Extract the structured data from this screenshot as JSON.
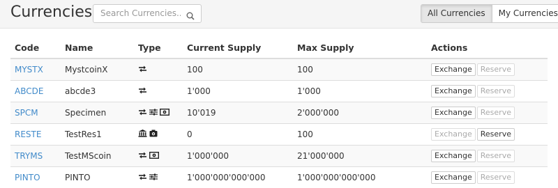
{
  "header": {
    "title": "Currencies",
    "search_placeholder": "Search Currencies..",
    "tabs": [
      {
        "label": "All Currencies",
        "active": true
      },
      {
        "label": "My Currencies",
        "active": false
      }
    ]
  },
  "table": {
    "columns": [
      "Code",
      "Name",
      "Type",
      "Current Supply",
      "Max Supply",
      "Actions"
    ],
    "actions": {
      "exchange": "Exchange",
      "reserve": "Reserve"
    },
    "rows": [
      {
        "code": "MYSTX",
        "name": "MystcoinX",
        "types": [
          "exchangeable-icon"
        ],
        "current": "100",
        "max": "100",
        "exchange_enabled": true,
        "reserve_enabled": false
      },
      {
        "code": "ABCDE",
        "name": "abcde3",
        "types": [
          "exchangeable-icon"
        ],
        "current": "1'000",
        "max": "1'000",
        "exchange_enabled": true,
        "reserve_enabled": false
      },
      {
        "code": "SPCM",
        "name": "Specimen",
        "types": [
          "exchangeable-icon",
          "controllable-icon",
          "mintable-icon"
        ],
        "current": "10'019",
        "max": "2'000'000",
        "exchange_enabled": true,
        "reserve_enabled": false
      },
      {
        "code": "RESTE",
        "name": "TestRes1",
        "types": [
          "reservable-icon",
          "claimable-icon"
        ],
        "current": "0",
        "max": "100",
        "exchange_enabled": false,
        "reserve_enabled": true
      },
      {
        "code": "TRYMS",
        "name": "TestMScoin",
        "types": [
          "exchangeable-icon",
          "mintable-icon"
        ],
        "current": "1'000'000",
        "max": "21'000'000",
        "exchange_enabled": true,
        "reserve_enabled": false
      },
      {
        "code": "PINTO",
        "name": "PINTO",
        "types": [
          "exchangeable-icon",
          "controllable-icon"
        ],
        "current": "1'000'000'000'000",
        "max": "1'000'000'000'000",
        "exchange_enabled": true,
        "reserve_enabled": false
      }
    ]
  },
  "colors": {
    "link": "#428bca",
    "stripe": "#f9f9f9",
    "header_bg": "#f5f5f5"
  }
}
